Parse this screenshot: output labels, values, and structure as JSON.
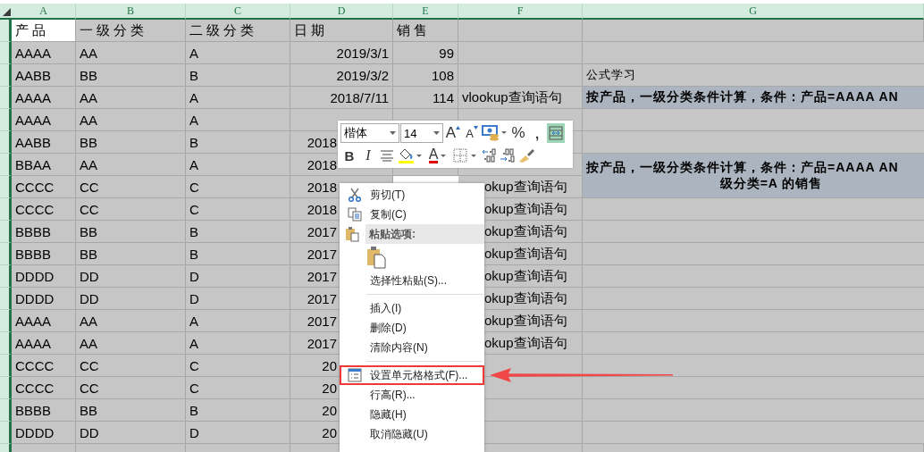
{
  "columns": [
    "A",
    "B",
    "C",
    "D",
    "E",
    "F",
    "G"
  ],
  "header": [
    {
      "text": "产品",
      "selected": true
    },
    {
      "text": "一级分类",
      "selected": false
    },
    {
      "text": "二级分类",
      "selected": false
    },
    {
      "text": "日期",
      "selected": false
    },
    {
      "text": "销售",
      "selected": false
    }
  ],
  "rows": [
    {
      "cells": [
        "AAAA",
        "AA",
        "A",
        "2019/3/1",
        "99"
      ]
    },
    {
      "cells": [
        "AABB",
        "BB",
        "B",
        "2019/3/2",
        "108"
      ],
      "g": {
        "lines": [
          "公式学习"
        ],
        "highlighted": false,
        "merged_with_next": false
      }
    },
    {
      "cells": [
        "AAAA",
        "AA",
        "A",
        "2018/7/11",
        "114"
      ],
      "f": "vlookup查询语句",
      "g": {
        "lines": [
          "按产品，一级分类条件计算，条件：产品=AAAA AN"
        ],
        "highlighted": true,
        "merged_with_next": false
      }
    },
    {
      "cells": [
        "AAAA",
        "AA",
        "A"
      ]
    },
    {
      "cells": [
        "AABB",
        "BB",
        "B",
        "2018"
      ]
    },
    {
      "cells": [
        "BBAA",
        "AA",
        "A",
        "2018"
      ],
      "g": {
        "lines": [
          "按产品，一级分类条件计算，条件：产品=AAAA AN",
          "级分类=A 的销售"
        ],
        "highlighted": true,
        "merged_with_next": true
      }
    },
    {
      "cells": [
        "CCCC",
        "CC",
        "C",
        "2018"
      ],
      "f": "okup查询语句"
    },
    {
      "cells": [
        "CCCC",
        "CC",
        "C",
        "2018"
      ],
      "f": "okup查询语句"
    },
    {
      "cells": [
        "BBBB",
        "BB",
        "B",
        "2017"
      ],
      "f": "okup查询语句"
    },
    {
      "cells": [
        "BBBB",
        "BB",
        "B",
        "2017"
      ],
      "f": "okup查询语句"
    },
    {
      "cells": [
        "DDDD",
        "DD",
        "D",
        "2017"
      ],
      "f": "okup查询语句"
    },
    {
      "cells": [
        "DDDD",
        "DD",
        "D",
        "2017"
      ],
      "f": "okup查询语句"
    },
    {
      "cells": [
        "AAAA",
        "AA",
        "A",
        "2017"
      ],
      "f": "okup查询语句"
    },
    {
      "cells": [
        "AAAA",
        "AA",
        "A",
        "2017"
      ],
      "f": "okup查询语句"
    },
    {
      "cells": [
        "CCCC",
        "CC",
        "C",
        "20"
      ]
    },
    {
      "cells": [
        "CCCC",
        "CC",
        "C",
        "20"
      ]
    },
    {
      "cells": [
        "BBBB",
        "BB",
        "B",
        "20"
      ]
    },
    {
      "cells": [
        "DDDD",
        "DD",
        "D",
        "20"
      ]
    }
  ],
  "toolbar": {
    "font": "楷体",
    "size": "14",
    "row1": [
      {
        "kind": "grow",
        "label": "A",
        "on": false
      },
      {
        "kind": "shrink",
        "label": "A",
        "on": false
      },
      {
        "kind": "accounting",
        "on": false
      },
      {
        "kind": "percent",
        "label": "%",
        "on": false
      },
      {
        "kind": "comma",
        "label": ",",
        "on": false
      },
      {
        "kind": "wrap",
        "on": true
      }
    ],
    "row2": [
      {
        "kind": "bold",
        "label": "B",
        "on": false
      },
      {
        "kind": "italic",
        "label": "I",
        "on": false
      },
      {
        "kind": "align",
        "on": false
      },
      {
        "kind": "fill",
        "on": false
      },
      {
        "kind": "fontcolor",
        "label": "A",
        "on": false
      },
      {
        "kind": "border",
        "on": false
      },
      {
        "kind": "decdec",
        "on": false
      },
      {
        "kind": "incdec",
        "on": false
      },
      {
        "kind": "painter",
        "on": false
      }
    ]
  },
  "menu": [
    {
      "kind": "item",
      "label": "剪切(T)",
      "highlighted": false
    },
    {
      "kind": "item",
      "label": "复制(C)",
      "highlighted": false
    },
    {
      "kind": "heading",
      "label": "粘贴选项:"
    },
    {
      "kind": "paste-icons"
    },
    {
      "kind": "item",
      "label": "选择性粘贴(S)...",
      "highlighted": false
    },
    {
      "kind": "separator"
    },
    {
      "kind": "item",
      "label": "插入(I)",
      "highlighted": false
    },
    {
      "kind": "item",
      "label": "删除(D)",
      "highlighted": false
    },
    {
      "kind": "item",
      "label": "清除内容(N)",
      "highlighted": false
    },
    {
      "kind": "separator"
    },
    {
      "kind": "item",
      "label": "设置单元格格式(F)...",
      "highlighted": true
    },
    {
      "kind": "item",
      "label": "行高(R)...",
      "highlighted": false
    },
    {
      "kind": "item",
      "label": "隐藏(H)",
      "highlighted": false
    },
    {
      "kind": "item",
      "label": "取消隐藏(U)",
      "highlighted": false
    }
  ]
}
